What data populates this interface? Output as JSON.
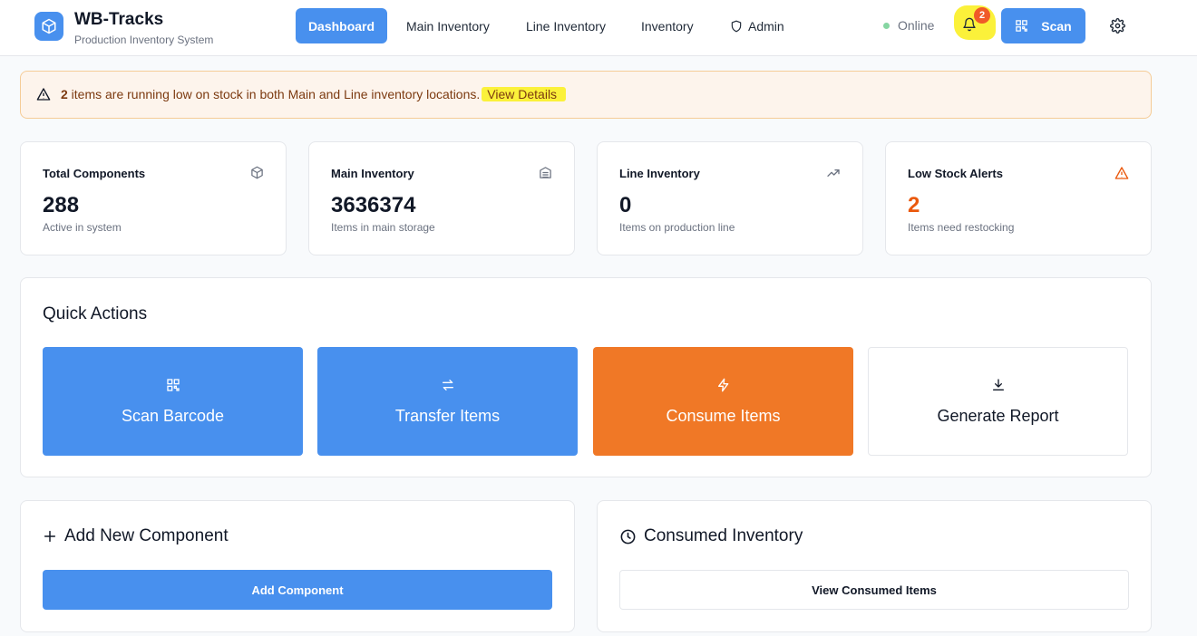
{
  "header": {
    "brand_title": "WB-Tracks",
    "brand_subtitle": "Production Inventory System",
    "nav": [
      {
        "label": "Dashboard",
        "active": true
      },
      {
        "label": "Main Inventory"
      },
      {
        "label": "Line Inventory"
      },
      {
        "label": "Inventory"
      },
      {
        "label": "Admin",
        "icon": "shield-icon"
      }
    ],
    "status": "Online",
    "notification_count": "2",
    "scan_label": "Scan",
    "colors": {
      "primary": "#4890ee",
      "status_online": "#86d6a2",
      "badge": "#f05a28"
    }
  },
  "alert": {
    "count": "2",
    "message": " items are running low on stock in both Main and Line inventory locations.",
    "link_label": "View Details",
    "colors": {
      "background": "#fdf4ec",
      "border": "#f5cc97",
      "text": "#7c3a10"
    }
  },
  "stats": [
    {
      "label": "Total Components",
      "value": "288",
      "sub": "Active in system",
      "icon": "box-icon"
    },
    {
      "label": "Main Inventory",
      "value": "3636374",
      "sub": "Items in main storage",
      "icon": "warehouse-icon"
    },
    {
      "label": "Line Inventory",
      "value": "0",
      "sub": "Items on production line",
      "icon": "trending-up-icon"
    },
    {
      "label": "Low Stock Alerts",
      "value": "2",
      "sub": "Items need restocking",
      "icon": "warning-icon",
      "accent": "#ea580c"
    }
  ],
  "quick_actions": {
    "title": "Quick Actions",
    "items": [
      {
        "label": "Scan Barcode",
        "icon": "qr-code-icon",
        "color": "#4890ee"
      },
      {
        "label": "Transfer Items",
        "icon": "transfer-icon",
        "color": "#4890ee"
      },
      {
        "label": "Consume Items",
        "icon": "lightning-icon",
        "color": "#f07826"
      },
      {
        "label": "Generate Report",
        "icon": "download-icon",
        "color": "#ffffff"
      }
    ]
  },
  "add_component": {
    "title": "Add New Component",
    "button_label": "Add Component"
  },
  "consumed_inventory": {
    "title": "Consumed Inventory",
    "button_label": "View Consumed Items"
  }
}
